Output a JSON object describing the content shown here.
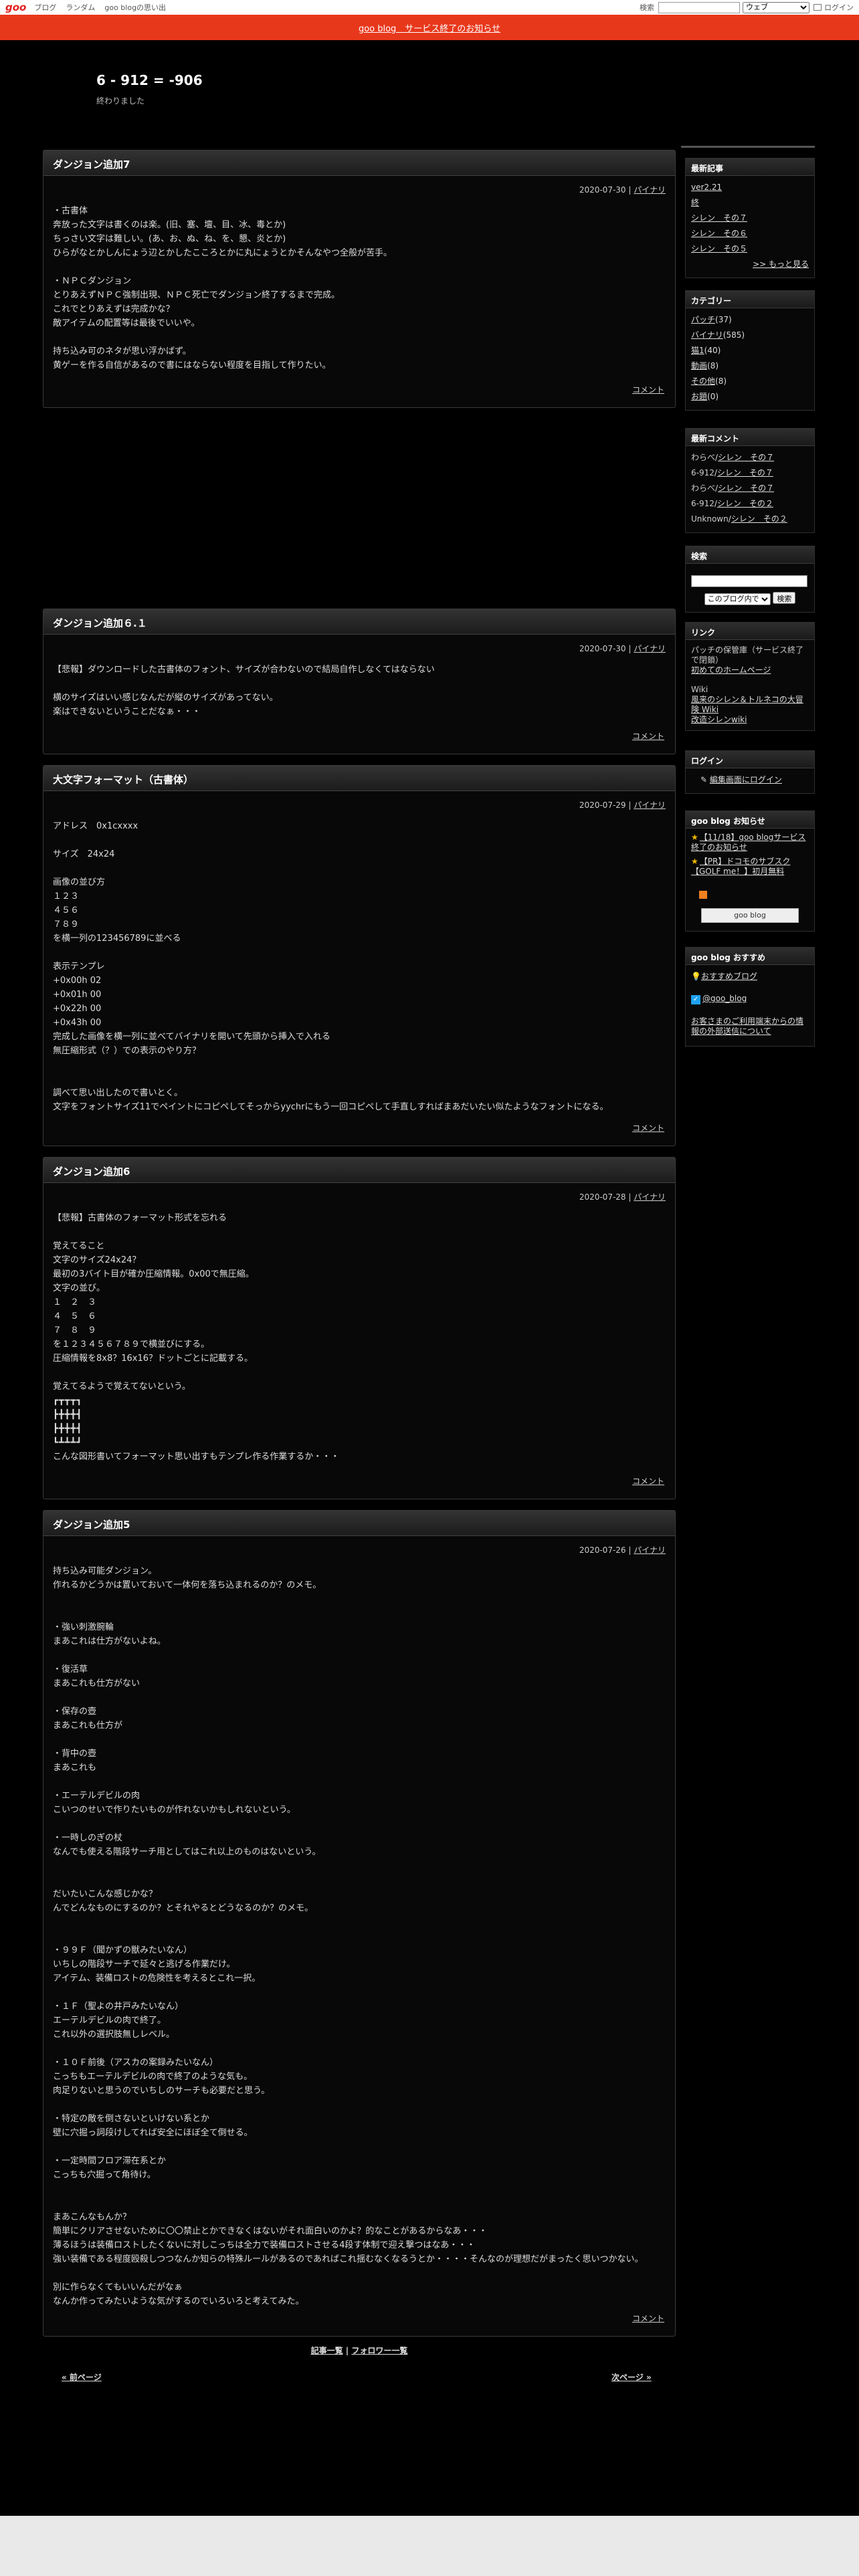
{
  "topnav": {
    "logo": "goo",
    "links": [
      "ブログ",
      "ランダム",
      "goo blogの思い出"
    ],
    "search_label": "検索",
    "search_scope": "ウェブ",
    "login": "ログイン"
  },
  "banner": "goo blog　サービス終了のお知らせ",
  "blog": {
    "title": "6 - 912 = -906",
    "desc": "終わりました"
  },
  "entries": [
    {
      "title": "ダンジョン追加7",
      "date": "2020-07-30",
      "category": "パイナリ",
      "body": "・古書体\n奔放った文字は書くのは楽。(旧、塞、壇、目、冰、毒とか)\nちっさい文字は難しい。(あ、お、ぬ、ね、を、懇、炎とか)\nひらがなとかしんにょう辺とかしたこころとかに丸にょうとかそんなやつ全般が苦手。\n\n・ＮＰＣダンジョン\nとりあえずＮＰＣ強制出現、ＮＰＣ死亡でダンジョン終了するまで完成。\nこれでとりあえずは完成かな？\n敵アイテムの配置等は最後でいいや。\n\n持ち込み可のネタが思い浮かばず。\n黄ゲーを作る自信があるので書にはならない程度を目指して作りたい。",
      "comment": "コメント"
    },
    {
      "title": "ダンジョン追加６.１",
      "date": "2020-07-30",
      "category": "パイナリ",
      "body": "【悲報】ダウンロードした古書体のフォント、サイズが合わないので結局自作しなくてはならない\n\n横のサイズはいい感じなんだが縦のサイズがあってない。\n楽はできないということだなぁ・・・",
      "comment": "コメント"
    },
    {
      "title": "大文字フォーマット（古書体）",
      "date": "2020-07-29",
      "category": "パイナリ",
      "body": "アドレス　0x1cxxxx\n\nサイズ　24x24\n\n画像の並び方\n１２３\n４５６\n７８９\nを横一列の123456789に並べる\n\n表示テンプレ\n+0x00h 02\n+0x01h 00\n+0x22h 00\n+0x43h 00\n完成した画像を横一列に並べてバイナリを開いて先頭から挿入で入れる\n無圧縮形式（？）での表示のやり方？\n\n\n調べて思い出したので書いとく。\n文字をフォントサイズ11でペイントにコピペしてそっからyychrにもう一回コピペして手直しすればまあだいたい似たようなフォントになる。",
      "comment": "コメント"
    },
    {
      "title": "ダンジョン追加6",
      "date": "2020-07-28",
      "category": "パイナリ",
      "body": "【悲報】古書体のフォーマット形式を忘れる\n\n覚えてること\n文字のサイズ24x24？\n最初の3バイト目が確か圧縮情報。0x00で無圧縮。\n文字の並び。\n１　２　３\n４　５　６\n７　８　９\nを１２３４５６７８９で横並びにする。\n圧縮情報を8x8？16x16？ドットごとに記載する。\n\n覚えてるようで覚えてないという。",
      "glyphs": "┏┳┳┳┓\n┣╋╋╋┫\n┣╋╋╋┫\n┗┻┻┻┛",
      "body2": "こんな図形書いてフォーマット思い出すもテンプレ作る作業するか・・・",
      "comment": "コメント"
    },
    {
      "title": "ダンジョン追加5",
      "date": "2020-07-26",
      "category": "パイナリ",
      "body": "持ち込み可能ダンジョン。\n作れるかどうかは置いておいて一体何を落ち込まれるのか？のメモ。\n\n\n・強い刺激腕輪\nまあこれは仕方がないよね。\n\n・復活草\nまあこれも仕方がない\n\n・保存の壺\nまあこれも仕方が\n\n・背中の壺\nまあこれも\n\n・エーテルデビルの肉\nこいつのせいで作りたいものが作れないかもしれないという。\n\n・一時しのぎの杖\nなんでも使える階段サーチ用としてはこれ以上のものはないという。\n\n\nだいたいこんな感じかな？\nんでどんなものにするのか？とそれやるとどうなるのか？のメモ。\n\n\n・９９Ｆ（聞かずの獣みたいなん）\nいちしの階段サーチで延々と逃げる作業だけ。\nアイテム、装備ロストの危険性を考えるとこれ一択。\n\n・１Ｆ（聖よの井戸みたいなん）\nエーテルデビルの肉で終了。\nこれ以外の選択肢無しレベル。\n\n・１０Ｆ前後（アスカの案録みたいなん）\nこっちもエーテルデビルの肉で終了のような気も。\n肉足りないと思うのでいちしのサーチも必要だと思う。\n\n・特定の敵を倒さないといけない系とか\n壁に穴掘っ詞段けしてれば安全にほぼ全て倒せる。\n\n・一定時間フロア滞在系とか\nこっちも穴掘って角待け。\n\n\nまあこんなもんか？\n簡単にクリアさせないために〇〇禁止とかできなくはないがそれ面白いのかよ？的なことがあるからなあ・・・\n薄るほうは装備ロストしたくないに対しこっちは全力で装備ロストさせる4段す体制で迎え撃つはなあ・・・\n強い装備である程度殴殺しつつなんか知らの特殊ルールがあるのであればこれ揺むなくなるうとか・・・・そんなのが理想だがまったく思いつかない。\n\n別に作らなくてもいいんだがなぁ\nなんか作ってみたいような気がするのでいろいろと考えてみた。",
      "comment": "コメント"
    }
  ],
  "sidebar": {
    "recent_title": "最新記事",
    "recent": [
      "ver2.21",
      "終",
      "シレン　その７",
      "シレン　その６",
      "シレン　その５"
    ],
    "recent_more": ">> もっと見る",
    "category_title": "カテゴリー",
    "categories": [
      {
        "name": "パッチ",
        "count": "(37)"
      },
      {
        "name": "バイナリ",
        "count": "(585)"
      },
      {
        "name": "猫1",
        "count": "(40)"
      },
      {
        "name": "動画",
        "count": "(8)"
      },
      {
        "name": "その他",
        "count": "(8)"
      },
      {
        "name": "お題",
        "count": "(0)"
      }
    ],
    "comment_title": "最新コメント",
    "comments": [
      {
        "who": "わらべ",
        "link": "シレン　その７"
      },
      {
        "who": "6-912",
        "link": "シレン　その７"
      },
      {
        "who": "わらべ",
        "link": "シレン　その７"
      },
      {
        "who": "6-912",
        "link": "シレン　その２"
      },
      {
        "who": "Unknown",
        "link": "シレン　その２"
      }
    ],
    "search_title": "検索",
    "search_scope": "このブログ内で",
    "search_button": "検索",
    "link_title": "リンク",
    "links_text1": "パッチの保管庫（サービス終了で閉鎖）",
    "links_link1": "初めてのホームページ",
    "links_text2": "Wiki",
    "links_link2": "風来のシレン＆トルネコの大冒険 Wiki",
    "links_link3": "改造シレンwiki",
    "login_title": "ログイン",
    "login_link": "編集画面にログイン",
    "notice_title": "goo blog お知らせ",
    "notices": [
      "【11/18】goo blogサービス終了のお知らせ",
      "【PR】ドコモのサブスク【GOLF me！】初月無料"
    ],
    "goo_button": "goo blog",
    "recommend_title": "goo blog おすすめ",
    "recommend_link": "おすすめブログ",
    "twitter_link": "@goo_blog",
    "ext_link": "お客さまのご利用端末からの情報の外部送信について"
  },
  "pagenav": {
    "articles": "記事一覧",
    "sep": "|",
    "followers": "フォロワー一覧",
    "prev": "« 前ページ",
    "next": "次ページ »"
  },
  "colors": {
    "accent": "#e8381c",
    "background": "#000000"
  }
}
